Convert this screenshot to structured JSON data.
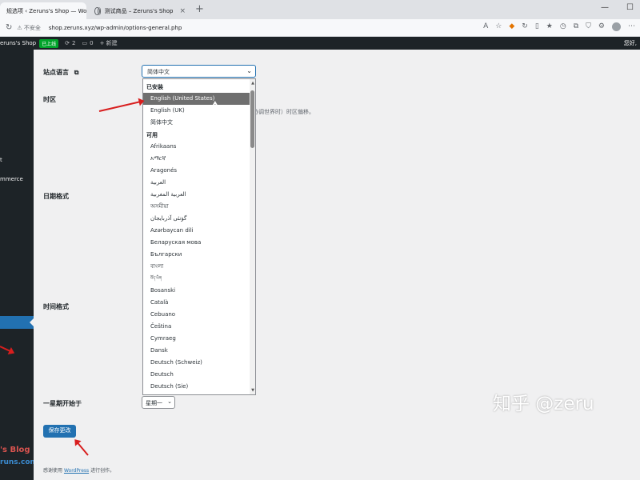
{
  "browser": {
    "tabs": [
      {
        "title": "规选项 ‹ Zeruns's Shop — Wo",
        "active": true
      },
      {
        "title": "测试商品 – Zeruns's Shop",
        "active": false
      }
    ],
    "security_label": "不安全",
    "url": "shop.zeruns.xyz/wp-admin/options-general.php"
  },
  "adminbar": {
    "site_name": "eruns's Shop",
    "live_badge": "已上线",
    "updates_count": "2",
    "comments_count": "0",
    "new_label": "+ 新建",
    "howdy": "您好,"
  },
  "sidebar": {
    "frag_t": "t",
    "frag_commerce": "mmerce"
  },
  "settings": {
    "site_language_label": "站点语言",
    "site_language_value": "简体中文",
    "timezone_label": "时区",
    "timezone_desc": "协调世界时）时区偏移。",
    "date_format_label": "日期格式",
    "time_format_label": "时间格式",
    "week_starts_label": "一星期开始于",
    "week_starts_value": "星期一",
    "save_button": "保存更改"
  },
  "dropdown": {
    "installed_group": "已安装",
    "installed": [
      "English (United States)",
      "English (UK)",
      "简体中文"
    ],
    "available_group": "可用",
    "available": [
      "Afrikaans",
      "አማርኛ",
      "Aragonés",
      "العربية",
      "العربية المغربية",
      "অসমীয়া",
      "گؤنئی آذربایجان",
      "Azərbaycan dili",
      "Беларуская мова",
      "Български",
      "বাংলা",
      "བོད་ཡིག",
      "Bosanski",
      "Català",
      "Cebuano",
      "Čeština",
      "Cymraeg",
      "Dansk",
      "Deutsch (Schweiz)",
      "Deutsch",
      "Deutsch (Sie)"
    ],
    "selected_index": 0
  },
  "footer": {
    "prefix": "感谢使用",
    "link": "WordPress",
    "suffix": "进行创作。"
  },
  "watermarks": {
    "blog": "'s Blog",
    "blog_url": "runs.com",
    "zhihu": "知乎 @zeru"
  }
}
